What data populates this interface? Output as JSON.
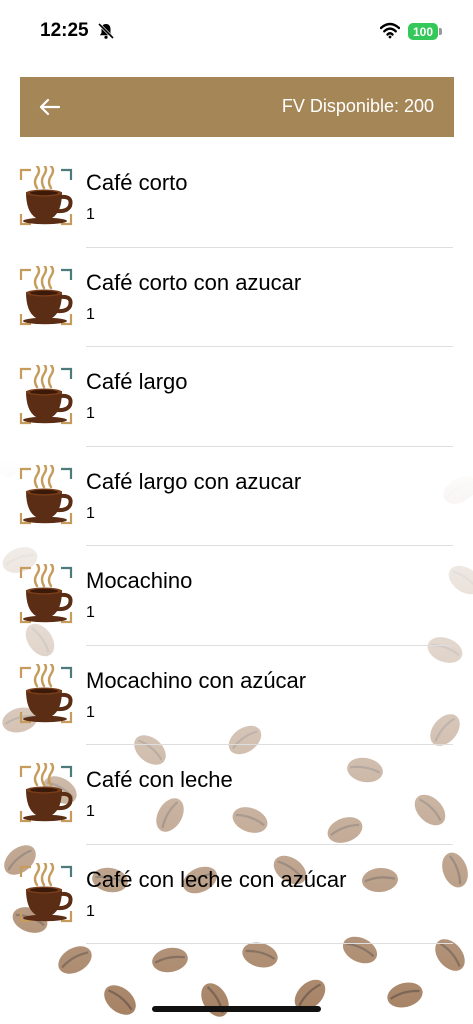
{
  "status_bar": {
    "time": "12:25",
    "battery": "100"
  },
  "header": {
    "title": "FV Disponible: 200",
    "back_icon": "arrow-left-icon"
  },
  "products": [
    {
      "name": "Café corto",
      "quantity": "1"
    },
    {
      "name": "Café corto con azucar",
      "quantity": "1"
    },
    {
      "name": "Café largo",
      "quantity": "1"
    },
    {
      "name": "Café largo con azucar",
      "quantity": "1"
    },
    {
      "name": "Mocachino",
      "quantity": "1"
    },
    {
      "name": "Mocachino con azúcar",
      "quantity": "1"
    },
    {
      "name": "Café con leche",
      "quantity": "1"
    },
    {
      "name": "Café con leche con azúcar",
      "quantity": "1"
    }
  ],
  "colors": {
    "header": "#a58657",
    "battery": "#34c759",
    "cup": "#5a2d14",
    "bracket": "#c69c5d"
  }
}
